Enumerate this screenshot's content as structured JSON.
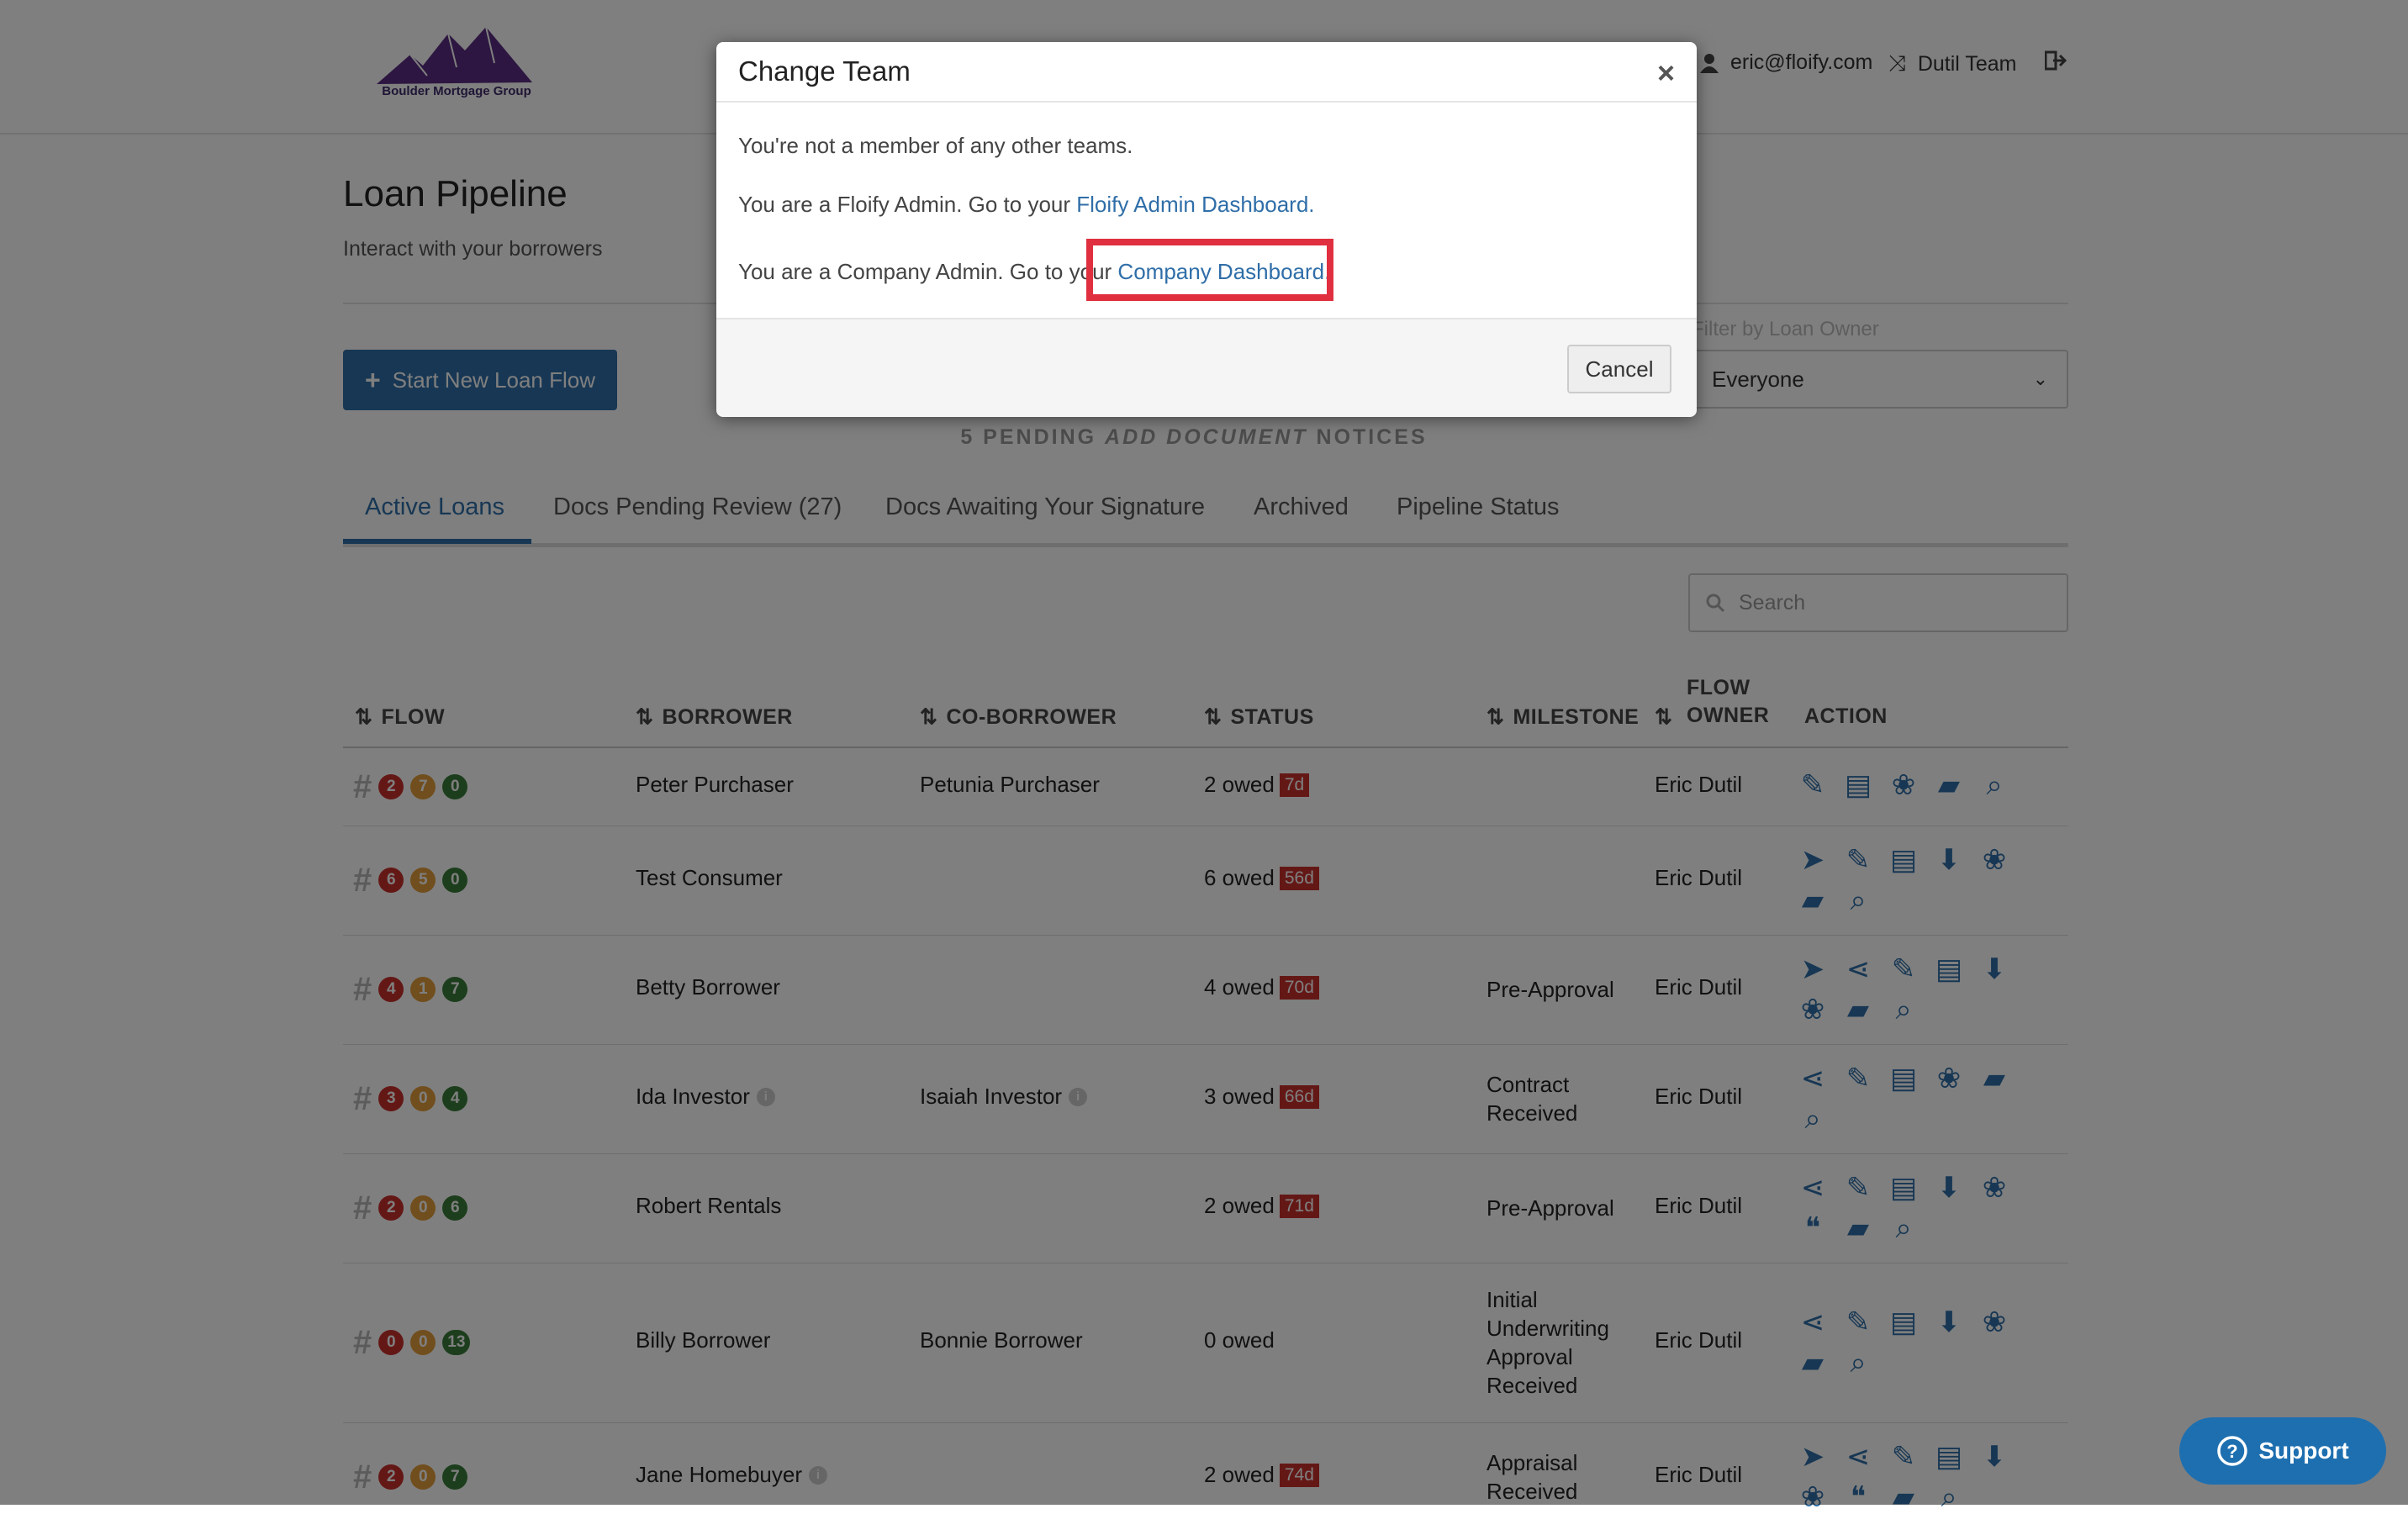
{
  "header": {
    "logo_text": "Boulder Mortgage Group",
    "user_email": "eric@floify.com",
    "team_name": "Dutil Team"
  },
  "page": {
    "title": "Loan Pipeline",
    "subtitle": "Interact with your borrowers",
    "start_button": "Start New Loan Flow",
    "notice_prefix": "5 PENDING ",
    "notice_em": "ADD DOCUMENT",
    "notice_suffix": " NOTICES",
    "owner_filter_label": "Filter by Loan Owner",
    "owner_filter_value": "Everyone",
    "search_placeholder": "Search"
  },
  "tabs": [
    {
      "label": "Active Loans"
    },
    {
      "label": "Docs Pending Review (27)"
    },
    {
      "label": "Docs Awaiting Your Signature"
    },
    {
      "label": "Archived"
    },
    {
      "label": "Pipeline Status"
    }
  ],
  "table": {
    "headers": {
      "flow": "FLOW",
      "borrower": "BORROWER",
      "coborrower": "CO-BORROWER",
      "status": "STATUS",
      "milestone": "MILESTONE",
      "owner_line1": "FLOW",
      "owner_line2": "OWNER",
      "action": "ACTION"
    },
    "rows": [
      {
        "b1": "2",
        "b2": "7",
        "b3": "0",
        "borrower": "Peter Purchaser",
        "coborrower": "Petunia Purchaser",
        "owed": "2 owed",
        "days": "7d",
        "milestone_l1": "",
        "milestone_l2": "",
        "milestone_l3": "",
        "milestone_l4": "",
        "owner": "Eric Dutil"
      },
      {
        "b1": "6",
        "b2": "5",
        "b3": "0",
        "borrower": "Test Consumer",
        "coborrower": "",
        "owed": "6 owed",
        "days": "56d",
        "milestone_l1": "",
        "milestone_l2": "",
        "milestone_l3": "",
        "milestone_l4": "",
        "owner": "Eric Dutil"
      },
      {
        "b1": "4",
        "b2": "1",
        "b3": "7",
        "borrower": "Betty Borrower",
        "coborrower": "",
        "owed": "4 owed",
        "days": "70d",
        "milestone_l1": "Pre-Approval",
        "milestone_l2": "",
        "milestone_l3": "",
        "milestone_l4": "",
        "owner": "Eric Dutil"
      },
      {
        "b1": "3",
        "b2": "0",
        "b3": "4",
        "borrower": "Ida Investor",
        "coborrower": "Isaiah Investor",
        "owed": "3 owed",
        "days": "66d",
        "milestone_l1": "Contract",
        "milestone_l2": "Received",
        "milestone_l3": "",
        "milestone_l4": "",
        "owner": "Eric Dutil"
      },
      {
        "b1": "2",
        "b2": "0",
        "b3": "6",
        "borrower": "Robert Rentals",
        "coborrower": "",
        "owed": "2 owed",
        "days": "71d",
        "milestone_l1": "Pre-Approval",
        "milestone_l2": "",
        "milestone_l3": "",
        "milestone_l4": "",
        "owner": "Eric Dutil"
      },
      {
        "b1": "0",
        "b2": "0",
        "b3": "13",
        "borrower": "Billy Borrower",
        "coborrower": "Bonnie Borrower",
        "owed": "0 owed",
        "days": "",
        "milestone_l1": "Initial",
        "milestone_l2": "Underwriting",
        "milestone_l3": "Approval",
        "milestone_l4": "Received",
        "owner": "Eric Dutil"
      },
      {
        "b1": "2",
        "b2": "0",
        "b3": "7",
        "borrower": "Jane Homebuyer",
        "coborrower": "",
        "owed": "2 owed",
        "days": "74d",
        "milestone_l1": "Appraisal",
        "milestone_l2": "Received",
        "milestone_l3": "",
        "milestone_l4": "",
        "owner": "Eric Dutil"
      }
    ]
  },
  "modal": {
    "title": "Change Team",
    "close": "×",
    "line1": "You're not a member of any other teams.",
    "line2_prefix": "You are a Floify Admin. Go to your ",
    "line2_link": "Floify Admin Dashboard.",
    "line3_prefix": "You are a Company Admin. Go to your ",
    "line3_link": "Company Dashboard.",
    "cancel": "Cancel"
  },
  "support": {
    "label": "Support"
  },
  "colors": {
    "primary": "#2f6ea8",
    "danger": "#c9302c",
    "warning": "#e39d3a",
    "success": "#3a7d3a",
    "logo": "#5a2d82"
  }
}
